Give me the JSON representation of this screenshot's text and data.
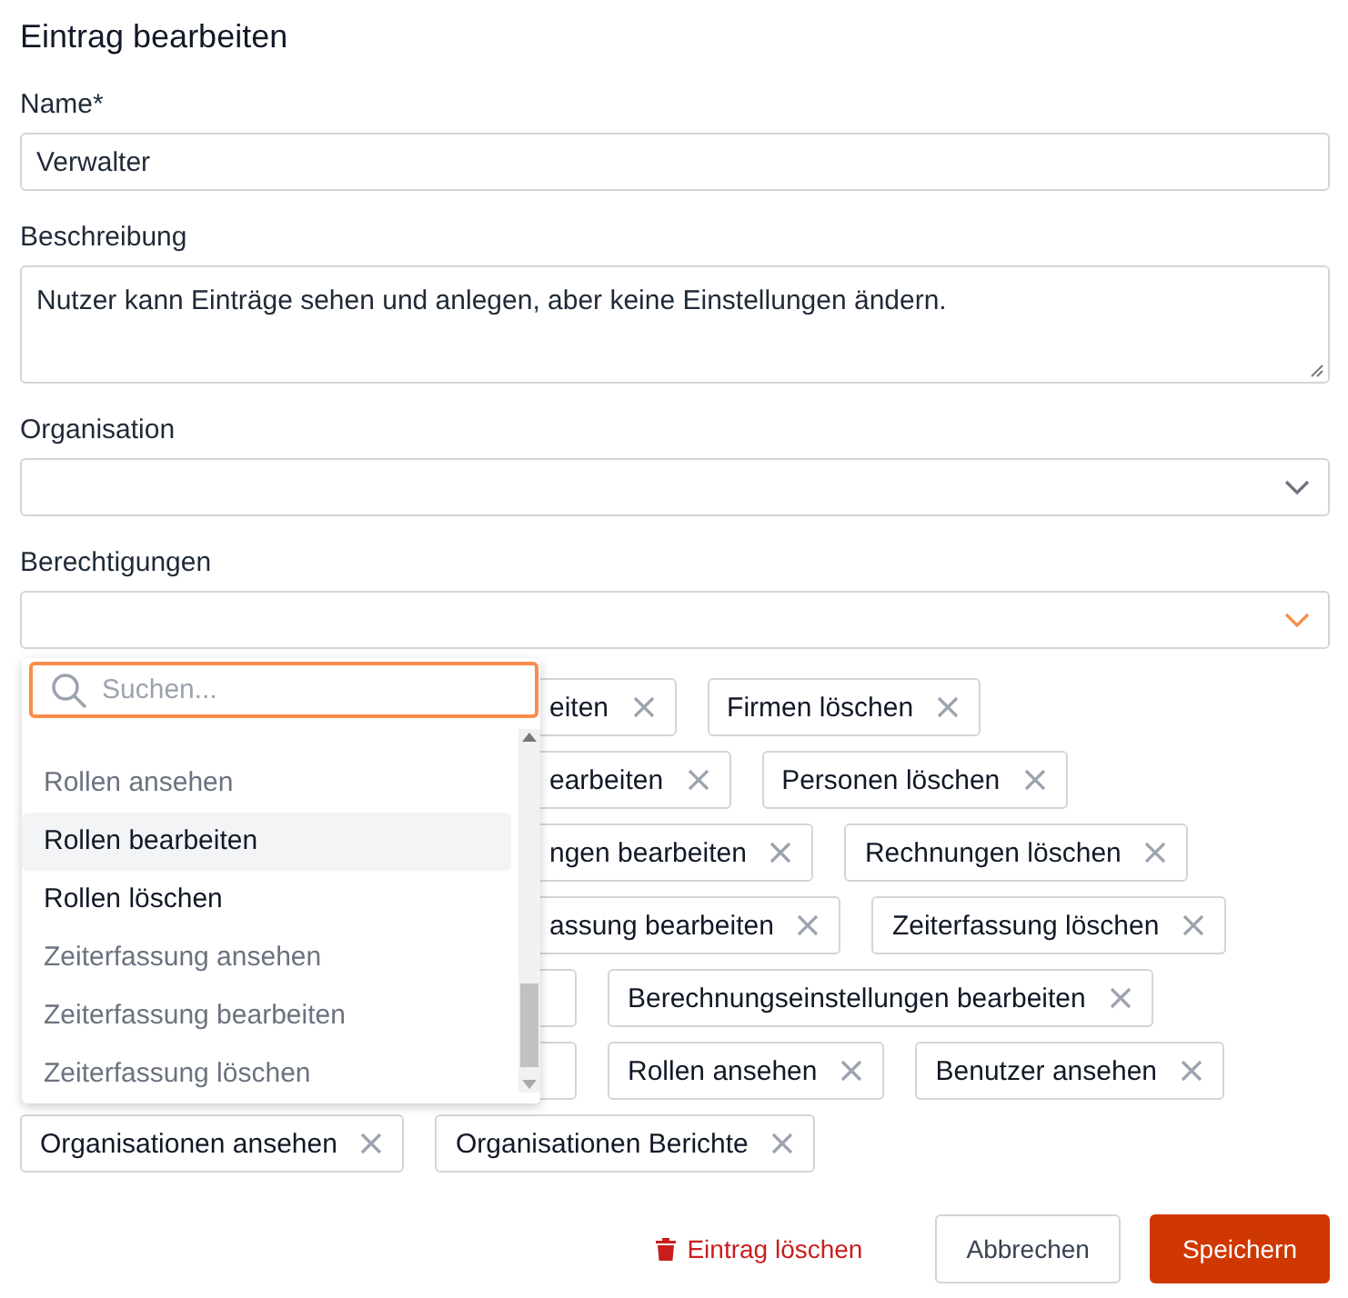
{
  "title": "Eintrag bearbeiten",
  "fields": [
    {
      "kind": "input",
      "label": "Name*",
      "value": "Verwalter"
    },
    {
      "kind": "textarea",
      "label": "Beschreibung",
      "value": "Nutzer kann Einträge sehen und anlegen, aber keine Einstellungen ändern."
    },
    {
      "kind": "select",
      "label": "Organisation",
      "focused": false
    },
    {
      "kind": "select",
      "label": "Berechtigungen",
      "focused": true
    }
  ],
  "tag_rows": [
    [
      {
        "kind": "partial",
        "label": "eiten"
      },
      {
        "kind": "tag",
        "label": "Firmen löschen"
      }
    ],
    [
      {
        "kind": "partial",
        "label": "earbeiten"
      },
      {
        "kind": "tag",
        "label": "Personen löschen"
      }
    ],
    [
      {
        "kind": "partial",
        "label": "ngen bearbeiten"
      },
      {
        "kind": "tag",
        "label": "Rechnungen löschen"
      }
    ],
    [
      {
        "kind": "partial",
        "label": "assung bearbeiten"
      },
      {
        "kind": "tag",
        "label": "Zeiterfassung löschen"
      }
    ],
    [
      {
        "kind": "edge"
      },
      {
        "kind": "tag",
        "label": "Berechnungseinstellungen bearbeiten"
      }
    ],
    [
      {
        "kind": "edge"
      },
      {
        "kind": "tag",
        "label": "Rollen ansehen"
      },
      {
        "kind": "tag",
        "label": "Benutzer ansehen"
      }
    ],
    [
      {
        "kind": "tag",
        "label": "Organisationen ansehen"
      },
      {
        "kind": "tag",
        "label": "Organisationen Berichte"
      }
    ]
  ],
  "dropdown": {
    "placeholder": "Suchen...",
    "options": [
      {
        "label": "Rollen ansehen",
        "selected": true,
        "highlighted": false
      },
      {
        "label": "Rollen bearbeiten",
        "selected": false,
        "highlighted": true
      },
      {
        "label": "Rollen löschen",
        "selected": false,
        "highlighted": false
      },
      {
        "label": "Zeiterfassung ansehen",
        "selected": true,
        "highlighted": false
      },
      {
        "label": "Zeiterfassung bearbeiten",
        "selected": true,
        "highlighted": false
      },
      {
        "label": "Zeiterfassung löschen",
        "selected": true,
        "highlighted": false
      }
    ]
  },
  "actions": {
    "delete": "Eintrag löschen",
    "cancel": "Abbrechen",
    "save": "Speichern"
  }
}
